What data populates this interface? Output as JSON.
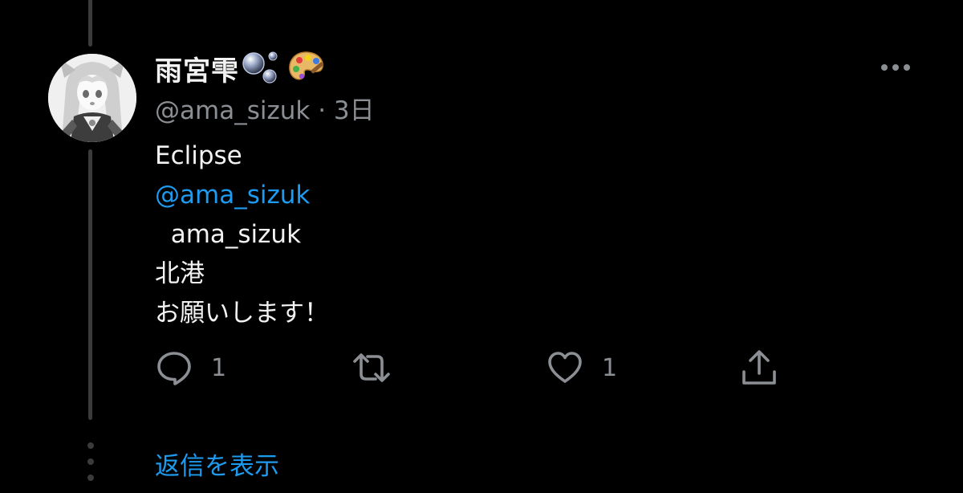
{
  "tweet": {
    "display_name": "雨宮雫",
    "display_name_emojis": [
      "bubbles-emoji",
      "palette-emoji"
    ],
    "handle": "@ama_sizuk",
    "separator": "·",
    "time": "3日",
    "body_lines": [
      {
        "text": "Eclipse",
        "type": "text"
      },
      {
        "text": "@ama_sizuk",
        "type": "mention"
      },
      {
        "text": "  ama_sizuk",
        "type": "text"
      },
      {
        "text": "北港",
        "type": "text"
      },
      {
        "text": "お願いします！",
        "type": "text"
      }
    ],
    "actions": {
      "reply": {
        "icon": "reply-icon",
        "count": "1"
      },
      "retweet": {
        "icon": "retweet-icon",
        "count": ""
      },
      "like": {
        "icon": "heart-icon",
        "count": "1"
      },
      "share": {
        "icon": "share-icon",
        "count": ""
      }
    },
    "more_icon": "more-icon"
  },
  "thread": {
    "show_replies_label": "返信を表示"
  },
  "colors": {
    "background": "#000000",
    "text_primary": "#f2f2f2",
    "text_secondary": "#8b8f94",
    "accent": "#1d9bf0",
    "thread_line": "#3a3b3d"
  }
}
